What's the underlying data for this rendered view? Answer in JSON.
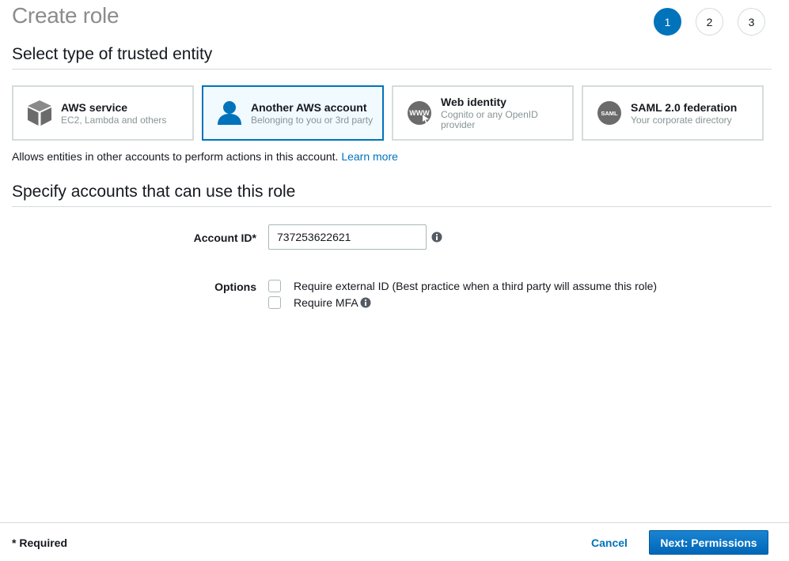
{
  "page": {
    "title": "Create role"
  },
  "steps": [
    {
      "label": "1",
      "active": true
    },
    {
      "label": "2",
      "active": false
    },
    {
      "label": "3",
      "active": false
    }
  ],
  "trusted_entity": {
    "heading": "Select type of trusted entity",
    "cards": [
      {
        "title": "AWS service",
        "subtitle": "EC2, Lambda and others",
        "icon": "cube-icon",
        "selected": false
      },
      {
        "title": "Another AWS account",
        "subtitle": "Belonging to you or 3rd party",
        "icon": "user-icon",
        "selected": true
      },
      {
        "title": "Web identity",
        "subtitle": "Cognito or any OpenID provider",
        "icon": "www-icon",
        "selected": false
      },
      {
        "title": "SAML 2.0 federation",
        "subtitle": "Your corporate directory",
        "icon": "saml-icon",
        "selected": false
      }
    ],
    "help_text": "Allows entities in other accounts to perform actions in this account.",
    "learn_more": "Learn more"
  },
  "accounts": {
    "heading": "Specify accounts that can use this role",
    "account_id_label": "Account ID*",
    "account_id_value": "737253622621",
    "options_label": "Options",
    "options": [
      {
        "label": "Require external ID (Best practice when a third party will assume this role)",
        "checked": false
      },
      {
        "label": "Require MFA",
        "checked": false,
        "has_info_icon": true
      }
    ]
  },
  "footer": {
    "required_note": "* Required",
    "cancel_label": "Cancel",
    "next_label": "Next: Permissions"
  },
  "colors": {
    "accent": "#0073bb",
    "selected_card_bg": "#f1faff",
    "muted_text": "#879596",
    "title_gray": "#8c8c8c"
  }
}
